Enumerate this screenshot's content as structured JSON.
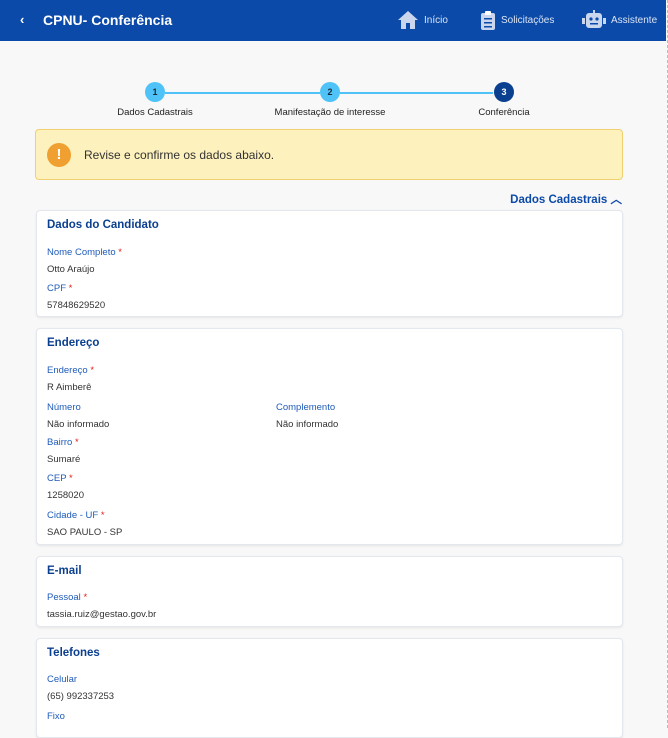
{
  "header": {
    "back": "‹",
    "title": "CPNU- Conferência",
    "nav": [
      {
        "label": "Início",
        "icon": "home-icon"
      },
      {
        "label": "Solicitações",
        "icon": "clipboard-icon"
      },
      {
        "label": "Assistente",
        "icon": "robot-icon"
      }
    ]
  },
  "steps": [
    {
      "num": "1",
      "label": "Dados Cadastrais"
    },
    {
      "num": "2",
      "label": "Manifestação de interesse"
    },
    {
      "num": "3",
      "label": "Conferência",
      "active": true
    }
  ],
  "alert": {
    "icon": "!",
    "text": "Revise e confirme os dados abaixo."
  },
  "section_toggle": "Dados Cadastrais",
  "candidato": {
    "title": "Dados do Candidato",
    "nome_label": "Nome Completo",
    "nome": "Otto Araújo",
    "cpf_label": "CPF",
    "cpf": "57848629520"
  },
  "endereco": {
    "title": "Endereço",
    "end_label": "Endereço",
    "end": "R Aimberê",
    "num_label": "Número",
    "num": "Não informado",
    "comp_label": "Complemento",
    "comp": "Não informado",
    "bairro_label": "Bairro",
    "bairro": "Sumaré",
    "cep_label": "CEP",
    "cep": "1258020",
    "cidade_label": "Cidade - UF",
    "cidade": "SAO PAULO - SP"
  },
  "email": {
    "title": "E-mail",
    "pessoal_label": "Pessoal",
    "pessoal": "tassia.ruiz@gestao.gov.br"
  },
  "telefones": {
    "title": "Telefones",
    "cel_label": "Celular",
    "cel": "(65) 992337253",
    "fixo_label": "Fixo"
  },
  "required_mark": "*"
}
